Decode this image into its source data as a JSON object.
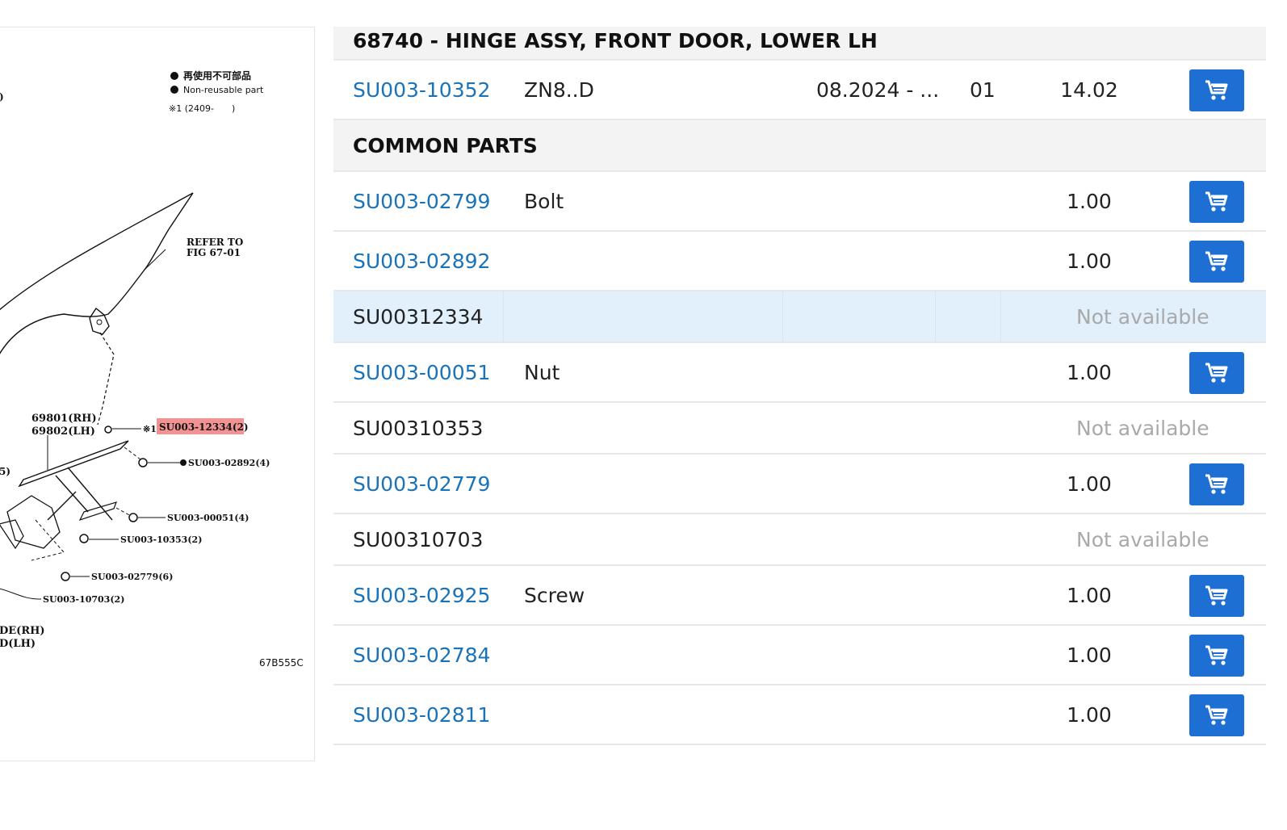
{
  "diagram": {
    "legend_jp": "再使用不可部品",
    "legend_en": "Non-reusable part",
    "note": "※1 (2409-　　)",
    "fig_code": "67B555C",
    "refer_to": [
      "REFER TO",
      "FIG 67-01"
    ],
    "callout_rh": "69801(RH)",
    "callout_lh": "69802(LH)",
    "callout_highlight": "SU003-12334(2)",
    "callout_highlight_prefix": "※1",
    "labels": [
      "SU003-02892(4)",
      "SU003-00051(4)",
      "SU003-10353(2)",
      "SU003-02779(6)",
      "SU003-10703(2)"
    ],
    "left_fragments": [
      ")",
      "5)",
      "DE(RH)",
      "D(LH)"
    ]
  },
  "parts_table": {
    "header_title": "68740 - HINGE ASSY, FRONT DOOR, LOWER LH",
    "rows": [
      {
        "part_no": "SU003-10352",
        "desc": "ZN8..D",
        "date": "08.2024 - ...",
        "qty": "01",
        "price": "14.02",
        "available": true
      },
      {
        "section": "COMMON PARTS"
      },
      {
        "part_no": "SU003-02799",
        "desc": "Bolt",
        "date": "",
        "qty": "",
        "price": "1.00",
        "available": true
      },
      {
        "part_no": "SU003-02892",
        "desc": "",
        "date": "",
        "qty": "",
        "price": "1.00",
        "available": true
      },
      {
        "part_no": "SU00312334",
        "desc": "",
        "date": "",
        "qty": "",
        "price": "",
        "available": false,
        "status": "Not available"
      },
      {
        "part_no": "SU003-00051",
        "desc": "Nut",
        "date": "",
        "qty": "",
        "price": "1.00",
        "available": true
      },
      {
        "part_no": "SU00310353",
        "desc": "",
        "date": "",
        "qty": "",
        "price": "",
        "available": false,
        "status": "Not available"
      },
      {
        "part_no": "SU003-02779",
        "desc": "",
        "date": "",
        "qty": "",
        "price": "1.00",
        "available": true
      },
      {
        "part_no": "SU00310703",
        "desc": "",
        "date": "",
        "qty": "",
        "price": "",
        "available": false,
        "status": "Not available"
      },
      {
        "part_no": "SU003-02925",
        "desc": "Screw",
        "date": "",
        "qty": "",
        "price": "1.00",
        "available": true
      },
      {
        "part_no": "SU003-02784",
        "desc": "",
        "date": "",
        "qty": "",
        "price": "1.00",
        "available": true
      },
      {
        "part_no": "SU003-02811",
        "desc": "",
        "date": "",
        "qty": "",
        "price": "1.00",
        "available": true
      }
    ]
  },
  "colors": {
    "link": "#1a73b8",
    "cart_button": "#1e6fd4",
    "highlight_row": "#e1f0fa",
    "section_bg": "#f3f3f3",
    "not_available": "#a9a9a9",
    "callout_highlight": "#f08080"
  },
  "icons": {
    "cart": "cart-icon"
  }
}
